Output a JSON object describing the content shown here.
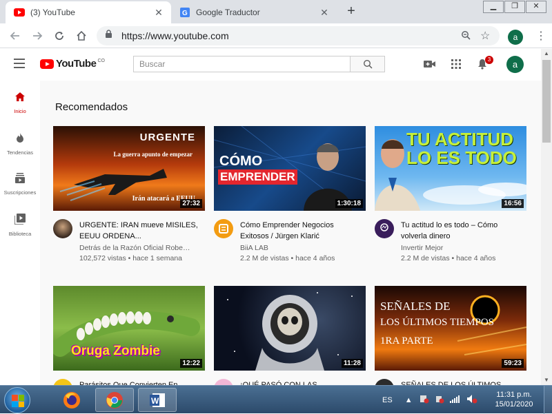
{
  "browser": {
    "tabs": [
      {
        "title": "(3) YouTube",
        "favicon": "youtube-favicon",
        "active": true
      },
      {
        "title": "Google Traductor",
        "favicon": "google-translate-favicon",
        "active": false
      }
    ],
    "new_tab_label": "+",
    "address": "https://www.youtube.com",
    "profile_initial": "a",
    "window_controls": [
      "minimize",
      "maximize",
      "close"
    ]
  },
  "youtube": {
    "logo_text": "YouTube",
    "logo_country": "CO",
    "search_placeholder": "Buscar",
    "notification_count": "3",
    "account_initial": "a",
    "sidebar": [
      {
        "label": "Inicio",
        "icon": "home-icon",
        "active": true
      },
      {
        "label": "Tendencias",
        "icon": "flame-icon",
        "active": false
      },
      {
        "label": "Suscripciones",
        "icon": "subscriptions-icon",
        "active": false
      },
      {
        "label": "Biblioteca",
        "icon": "library-icon",
        "active": false
      }
    ],
    "section_title": "Recomendados",
    "videos": [
      {
        "title": "URGENTE: IRAN mueve MISILES, EEUU ORDENA...",
        "channel": "Detrás de la Razón Oficial Robe…",
        "stats": "102,572 vistas • hace 1 semana",
        "duration": "27:32",
        "thumb_text": [
          "URGENTE",
          "La guerra apunto de empezar",
          "Irán atacará a EEUU"
        ]
      },
      {
        "title": "Cómo Emprender Negocios Exitosos / Jürgen Klarić",
        "channel": "BiiA LAB",
        "stats": "2.2 M de vistas • hace 4 años",
        "duration": "1:30:18",
        "thumb_text": [
          "CÓMO",
          "EMPRENDER"
        ]
      },
      {
        "title": "Tu actitud lo es todo – Cómo volverla dinero",
        "channel": "Invertir Mejor",
        "stats": "2.2 M de vistas • hace 4 años",
        "duration": "16:56",
        "thumb_text": [
          "TU ACTITUD",
          "LO ES TODO"
        ]
      },
      {
        "title": "Parásitos Que Convierten En",
        "duration": "12:22",
        "thumb_text": [
          "Oruga Zombie"
        ]
      },
      {
        "title": "¡QUÉ PASÓ CON LAS",
        "duration": "11:28",
        "thumb_text": []
      },
      {
        "title": "SEÑALES DE LOS ÚLTIMOS",
        "duration": "59:23",
        "thumb_text": [
          "SEÑALES DE",
          "LOS ÚLTIMOS TIEMPOS",
          "1RA PARTE"
        ]
      }
    ]
  },
  "taskbar": {
    "apps": [
      {
        "name": "firefox-icon",
        "open": false
      },
      {
        "name": "chrome-icon",
        "open": true
      },
      {
        "name": "word-icon",
        "open": true
      }
    ],
    "language": "ES",
    "time": "11:31 p.m.",
    "date": "15/01/2020"
  },
  "colors": {
    "youtube_red": "#ff0000",
    "active_red": "#cc0000",
    "avatar_green": "#0f6e4a",
    "background": "#f9f9f9"
  }
}
